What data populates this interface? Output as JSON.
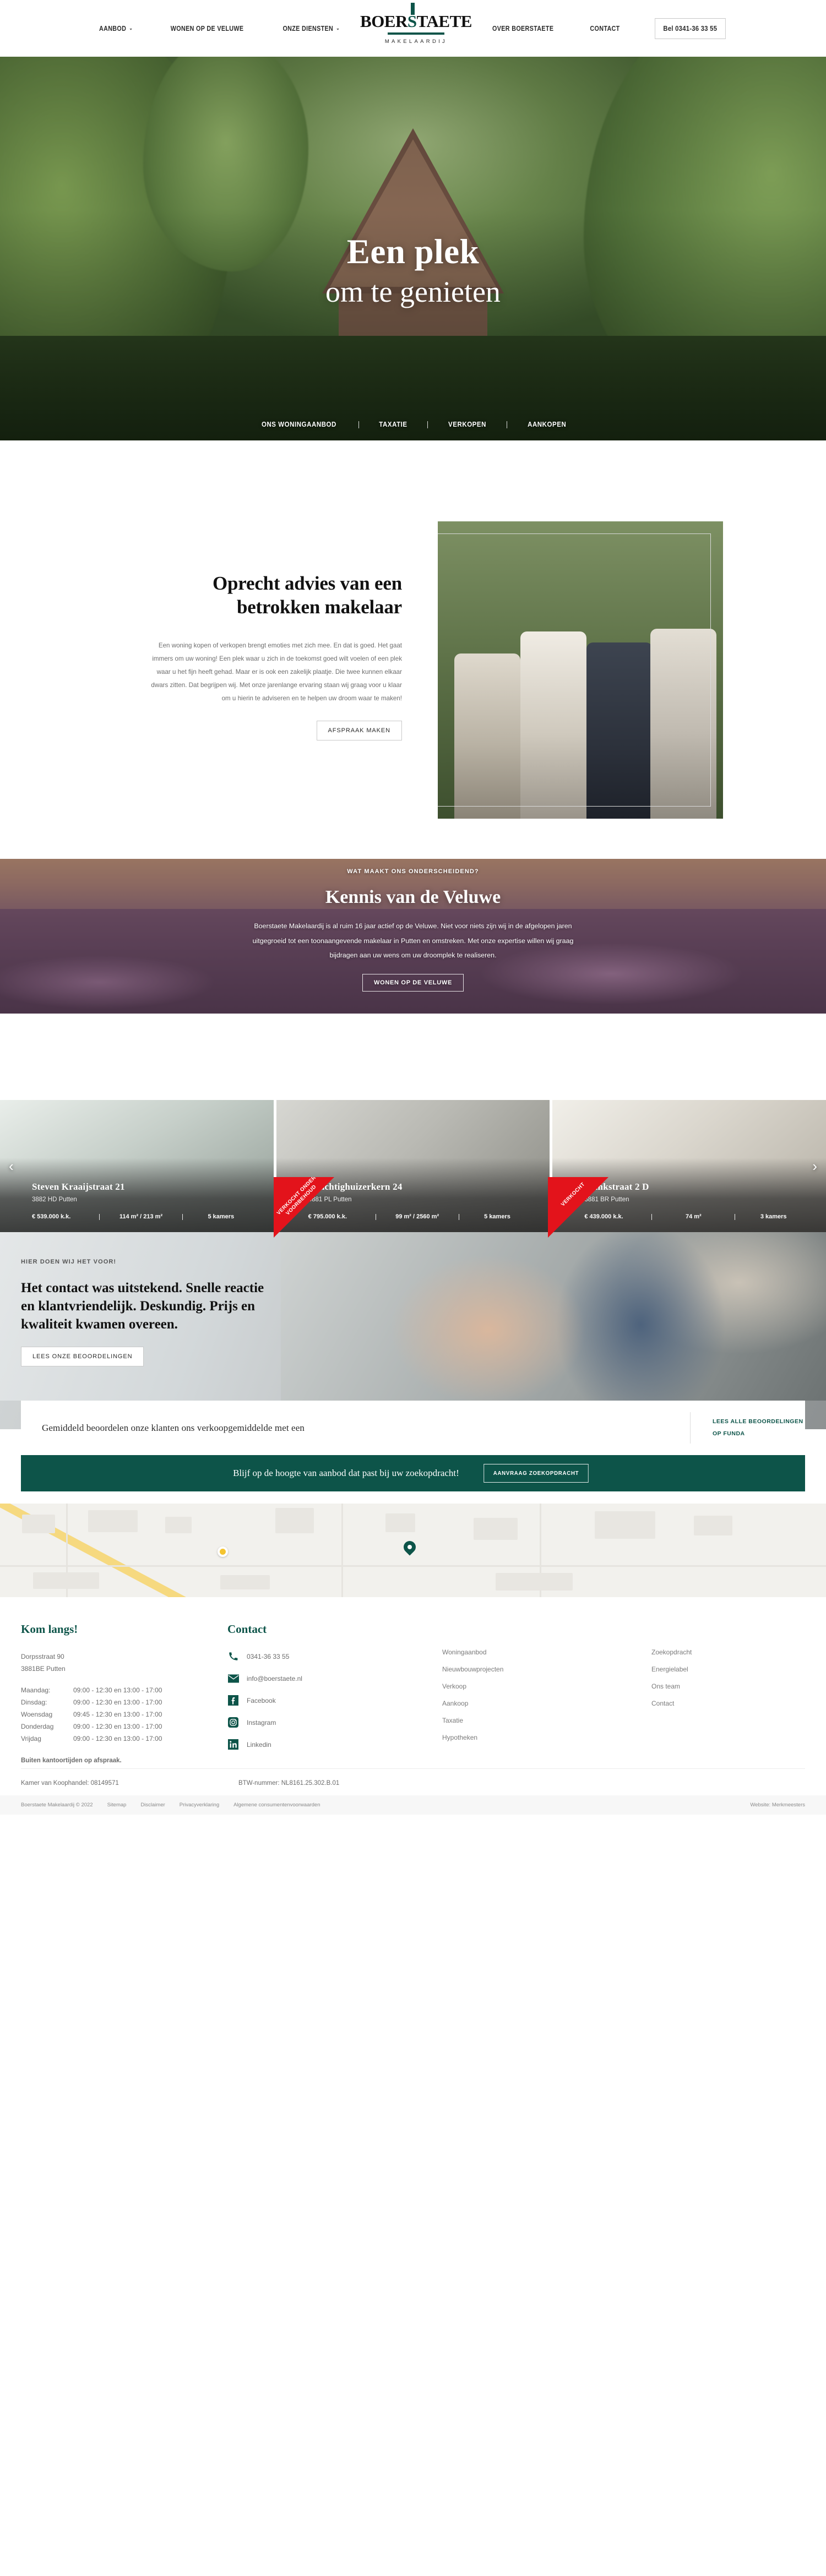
{
  "brand": {
    "accent": "#0d5449",
    "ribbon_red": "#e3131b",
    "logo_part1": "BOER",
    "logo_highlight": "S",
    "logo_part2": "TAETE",
    "logo_sub": "MAKELAARDIJ"
  },
  "nav": {
    "left": [
      {
        "label": "AANBOD",
        "caret": "⌄"
      },
      {
        "label": "WONEN OP DE VELUWE",
        "caret": ""
      },
      {
        "label": "ONZE DIENSTEN",
        "caret": "⌄"
      }
    ],
    "right": [
      {
        "label": "OVER BOERSTAETE"
      },
      {
        "label": "CONTACT"
      }
    ],
    "phone_button": "Bel 0341-36 33 55"
  },
  "hero": {
    "title": "Een plek",
    "subtitle": "om te genieten",
    "actions": [
      "ONS WONINGAANBOD",
      "TAXATIE",
      "VERKOPEN",
      "AANKOPEN"
    ]
  },
  "advice": {
    "heading": "Oprecht advies van een betrokken makelaar",
    "body": "Een woning kopen of verkopen brengt emoties met zich mee. En dat is goed. Het gaat immers om uw woning! Een plek waar u zich in de toekomst goed wilt voelen of een plek waar u het fijn heeft gehad. Maar er is ook een zakelijk plaatje. Die twee kunnen elkaar dwars zitten. Dat begrijpen wij. Met onze jarenlange ervaring staan wij graag voor u klaar om u hierin te adviseren en te helpen uw droom waar te maken!",
    "button": "AFSPRAAK MAKEN"
  },
  "veluwe": {
    "eyebrow": "WAT MAAKT ONS ONDERSCHEIDEND?",
    "heading": "Kennis van de Veluwe",
    "body": "Boerstaete Makelaardij is al ruim 16 jaar actief op de Veluwe. Niet voor niets zijn wij in de afgelopen jaren uitgegroeid tot een toonaangevende makelaar in Putten en omstreken. Met onze expertise willen wij graag bijdragen aan uw wens om uw droomplek te realiseren.",
    "button": "WONEN OP DE VELUWE"
  },
  "properties": {
    "prev_arrow": "‹",
    "next_arrow": "›",
    "items": [
      {
        "title": "Steven Kraaijstraat 21",
        "zip": "3882 HD Putten",
        "price": "€ 539.000 k.k.",
        "size": "114 m² / 213 m²",
        "rooms": "5 kamers",
        "ribbon": ""
      },
      {
        "title": "Krachtighuizerkern 24",
        "zip": "3881 PL Putten",
        "price": "€ 795.000 k.k.",
        "size": "99 m² / 2560 m²",
        "rooms": "5 kamers",
        "ribbon": "VERKOCHT ONDER VOORBEHOUD"
      },
      {
        "title": "Brinkstraat 2 D",
        "zip": "3881 BR Putten",
        "price": "€ 439.000 k.k.",
        "size": "74 m²",
        "rooms": "3 kamers",
        "ribbon": "VERKOCHT"
      }
    ]
  },
  "testimonial": {
    "eyebrow": "HIER DOEN WIJ HET VOOR!",
    "quote": "Het contact was uitstekend. Snelle reactie en klantvriendelijk. Deskundig. Prijs en kwaliteit kwamen overeen.",
    "button": "LEES ONZE BEOORDELINGEN"
  },
  "average_band": {
    "text": "Gemiddeld beoordelen onze klanten ons verkoopgemiddelde met een",
    "link": "LEES ALLE BEOORDELINGEN OP FUNDA"
  },
  "cta": {
    "text": "Blijf op de hoogte van aanbod dat past bij uw zoekopdracht!",
    "button": "AANVRAAG ZOEKOPDRACHT"
  },
  "footer": {
    "visit": {
      "heading": "Kom langs!",
      "street": "Dorpsstraat 90",
      "city": "3881BE Putten",
      "hours": [
        {
          "day": "Maandag:",
          "time": "09:00 - 12:30 en 13:00 - 17:00"
        },
        {
          "day": "Dinsdag:",
          "time": "09:00 - 12:30 en 13:00 - 17:00"
        },
        {
          "day": "Woensdag",
          "time": "09:45 - 12:30 en 13:00 - 17:00"
        },
        {
          "day": "Donderdag",
          "time": "09:00 - 12:30 en 13:00 - 17:00"
        },
        {
          "day": "Vrijdag",
          "time": "09:00 - 12:30 en 13:00 - 17:00"
        }
      ],
      "note": "Buiten kantoortijden op afspraak."
    },
    "contact": {
      "heading": "Contact",
      "items": [
        {
          "icon": "phone-icon",
          "label": "0341-36 33 55"
        },
        {
          "icon": "mail-icon",
          "label": "info@boerstaete.nl"
        },
        {
          "icon": "facebook-icon",
          "label": "Facebook"
        },
        {
          "icon": "instagram-icon",
          "label": "Instagram"
        },
        {
          "icon": "linkedin-icon",
          "label": "Linkedin"
        }
      ]
    },
    "links_col1": [
      "Woningaanbod",
      "Nieuwbouwprojecten",
      "Verkoop",
      "Aankoop",
      "Taxatie",
      "Hypotheken"
    ],
    "links_col2": [
      "Zoekopdracht",
      "Energielabel",
      "Ons team",
      "Contact"
    ],
    "legal": {
      "kvk": "Kamer van Koophandel: 08149571",
      "btw": "BTW-nummer: NL8161.25.302.B.01"
    },
    "copyright": {
      "text": "Boerstaete Makelaardij © 2022",
      "links": [
        "Sitemap",
        "Disclaimer",
        "Privacyverklaring",
        "Algemene consumentenvoorwaarden"
      ],
      "right": "Website: Merkmeesters"
    }
  }
}
